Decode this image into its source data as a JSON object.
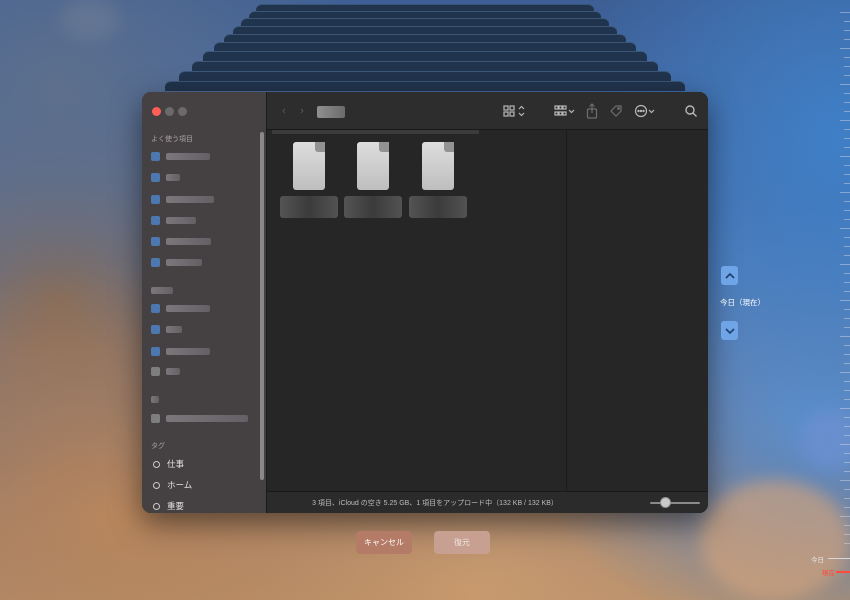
{
  "sidebar": {
    "favorites_heading": "よく使う項目",
    "tags_heading": "タグ",
    "tags": [
      {
        "label": "仕事"
      },
      {
        "label": "ホーム"
      },
      {
        "label": "重要"
      }
    ]
  },
  "status": {
    "text": "3 項目、iCloud の空き 5.25 GB、1 項目をアップロード中（132 KB / 132 KB）",
    "icon_size_level": 0.25
  },
  "buttons": {
    "cancel": "キャンセル",
    "restore": "復元"
  },
  "time_machine": {
    "current_label": "今日（現在）",
    "timeline_today": "今日",
    "timeline_now": "現在"
  },
  "colors": {
    "accent": "#6fa4e6",
    "cancel_button": "#b47b66",
    "restore_button": "#c7a092",
    "now_marker": "#ff4a3c"
  },
  "icons": {
    "close": "close-icon",
    "grid_view": "grid-view-icon",
    "group": "group-icon",
    "share": "share-icon",
    "tag": "tag-icon",
    "more": "ellipsis-icon",
    "search": "search-icon",
    "up": "chevron-up-icon",
    "down": "chevron-down-icon"
  }
}
